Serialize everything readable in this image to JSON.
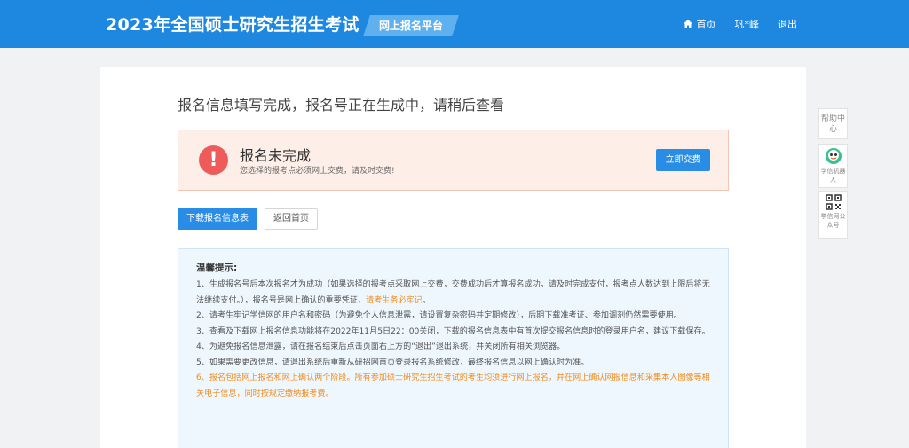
{
  "header": {
    "title": "2023年全国硕士研究生招生考试",
    "platform": "网上报名平台",
    "nav": {
      "home": "首页",
      "user": "巩*峰",
      "logout": "退出"
    }
  },
  "main": {
    "page_title": "报名信息填写完成，报名号正在生成中，请稍后查看",
    "alert": {
      "icon": "!",
      "title": "报名未完成",
      "subtitle": "您选择的报考点必须网上交费，请及时交费!",
      "pay_button": "立即交费"
    },
    "buttons": {
      "download": "下载报名信息表",
      "back_home": "返回首页"
    },
    "tips": {
      "title": "温馨提示:",
      "item1_text": "1、生成报名号后本次报名才为成功（如果选择的报考点采取网上交费，交费成功后才算报名成功，请及时完成支付，报考点人数达到上限后将无法继续支付。），报名号是网上确认的重要凭证，",
      "item1_highlight": "请考生务必牢记",
      "item1_end": "。",
      "item2": "2、请考生牢记学信网的用户名和密码（为避免个人信息泄露，请设置复杂密码并定期修改），后期下载准考证、参加调剂仍然需要使用。",
      "item3": "3、查看及下载网上报名信息功能将在2022年11月5日22：00关闭，下载的报名信息表中有首次提交报名信息时的登录用户名，建议下载保存。",
      "item4": "4、为避免报名信息泄露，请在报名结束后点击页面右上方的“退出”退出系统，并关闭所有相关浏览器。",
      "item5": "5、如果需要更改信息，请退出系统后重新从研招网首页登录报名系统修改，最终报名信息以网上确认时为准。",
      "item6": "6、报名包括网上报名和网上确认两个阶段。所有参加硕士研究生招生考试的考生均须进行网上报名，并在网上确认网报信息和采集本人图像等相关电子信息，同时按规定缴纳报考费。"
    }
  },
  "side": {
    "help": "帮助中心",
    "robot": "学信机器人",
    "qr": "学信网公众号"
  },
  "colors": {
    "primary": "#1e87e0",
    "button": "#2a8de5",
    "danger": "#ee5b5b",
    "highlight": "#f08c1f",
    "tips_bg": "#eef7fe"
  },
  "icons": {
    "home": "home-icon",
    "alert": "exclamation-icon",
    "robot": "robot-icon",
    "qr": "qr-code-icon"
  }
}
